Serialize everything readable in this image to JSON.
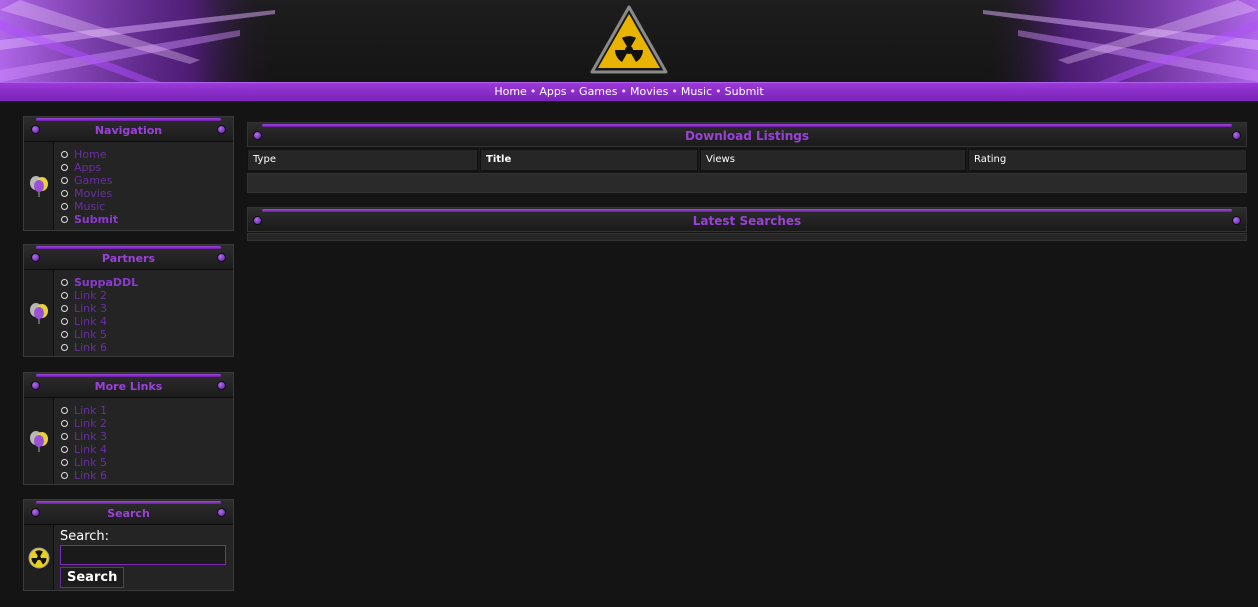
{
  "nav": {
    "items": [
      "Home",
      "Apps",
      "Games",
      "Movies",
      "Music",
      "Submit"
    ],
    "separator": "•"
  },
  "sidebar": {
    "navigation": {
      "title": "Navigation",
      "items": [
        "Home",
        "Apps",
        "Games",
        "Movies",
        "Music",
        "Submit"
      ]
    },
    "partners": {
      "title": "Partners",
      "items": [
        "SuppaDDL",
        "Link 2",
        "Link 3",
        "Link 4",
        "Link 5",
        "Link 6"
      ]
    },
    "more_links": {
      "title": "More Links",
      "items": [
        "Link 1",
        "Link 2",
        "Link 3",
        "Link 4",
        "Link 5",
        "Link 6"
      ]
    },
    "search": {
      "title": "Search",
      "label": "Search:",
      "value": "",
      "button": "Search"
    }
  },
  "main": {
    "downloads": {
      "title": "Download Listings",
      "columns": [
        "Type",
        "Title",
        "Views",
        "Rating"
      ]
    },
    "latest_searches": {
      "title": "Latest Searches"
    }
  },
  "colors": {
    "accent": "#9a42d8",
    "navbar": "#8a2ec8",
    "background": "#141414"
  }
}
